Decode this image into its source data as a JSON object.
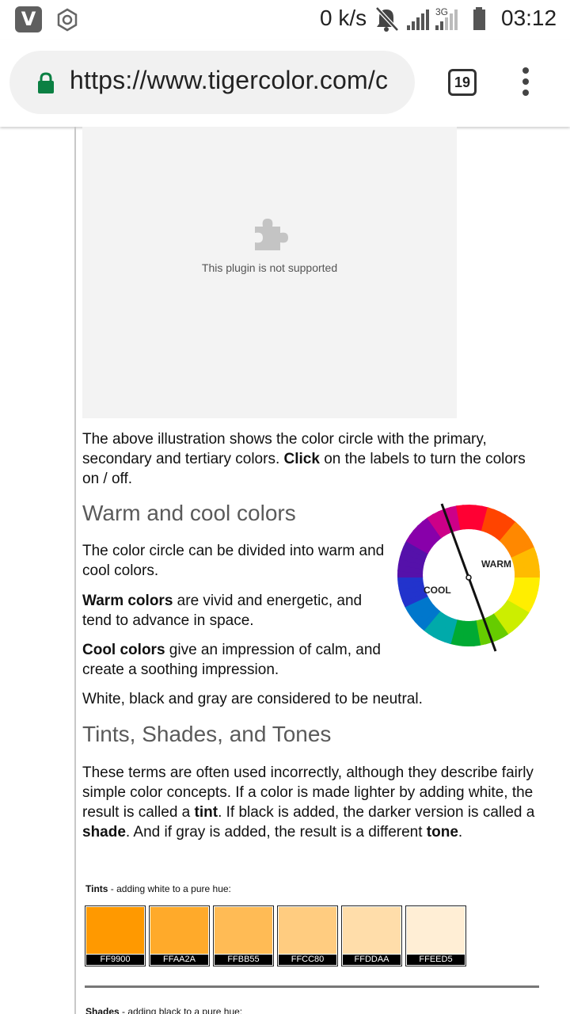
{
  "status_bar": {
    "app_badge": "V",
    "speed": "0 k/s",
    "network": "3G",
    "time": "03:12"
  },
  "browser": {
    "url": "https://www.tigercolor.com/c",
    "tab_count": "19"
  },
  "plugin": {
    "message": "This plugin is not supported"
  },
  "intro": {
    "text_before": "The above illustration shows the color circle with the primary, secondary and tertiary colors. ",
    "bold": "Click",
    "text_after": " on the labels to turn the colors on / off."
  },
  "warm_cool": {
    "heading": "Warm and cool colors",
    "p1": "The color circle can be divided into warm and cool colors.",
    "p2_bold": "Warm colors",
    "p2_rest": " are vivid and energetic, and tend to advance in space.",
    "p3_bold": "Cool colors",
    "p3_rest": " give an impression of calm, and create a soothing impression.",
    "p4": "White, black and gray are considered to be neutral.",
    "wheel_warm_label": "WARM",
    "wheel_cool_label": "COOL"
  },
  "tints_shades": {
    "heading": "Tints, Shades, and Tones",
    "t1": "These terms are often used incorrectly, although they describe fairly simple color concepts. If a color is made lighter by adding white, the result is called a ",
    "b1": "tint",
    "t2": ". If black is added, the darker version is called a ",
    "b2": "shade",
    "t3": ". And if gray is added, the result is a different ",
    "b3": "tone",
    "t4": ".",
    "tints_label_bold": "Tints",
    "tints_label_rest": " - adding white to a pure hue:",
    "tints": [
      {
        "hex": "FF9900",
        "color": "#FF9900"
      },
      {
        "hex": "FFAA2A",
        "color": "#FFAA2A"
      },
      {
        "hex": "FFBB55",
        "color": "#FFBB55"
      },
      {
        "hex": "FFCC80",
        "color": "#FFCC80"
      },
      {
        "hex": "FFDDAA",
        "color": "#FFDDAA"
      },
      {
        "hex": "FFEED5",
        "color": "#FFEED5"
      }
    ],
    "shades_label_bold": "Shades",
    "shades_label_rest": " - adding black to a pure hue:"
  }
}
